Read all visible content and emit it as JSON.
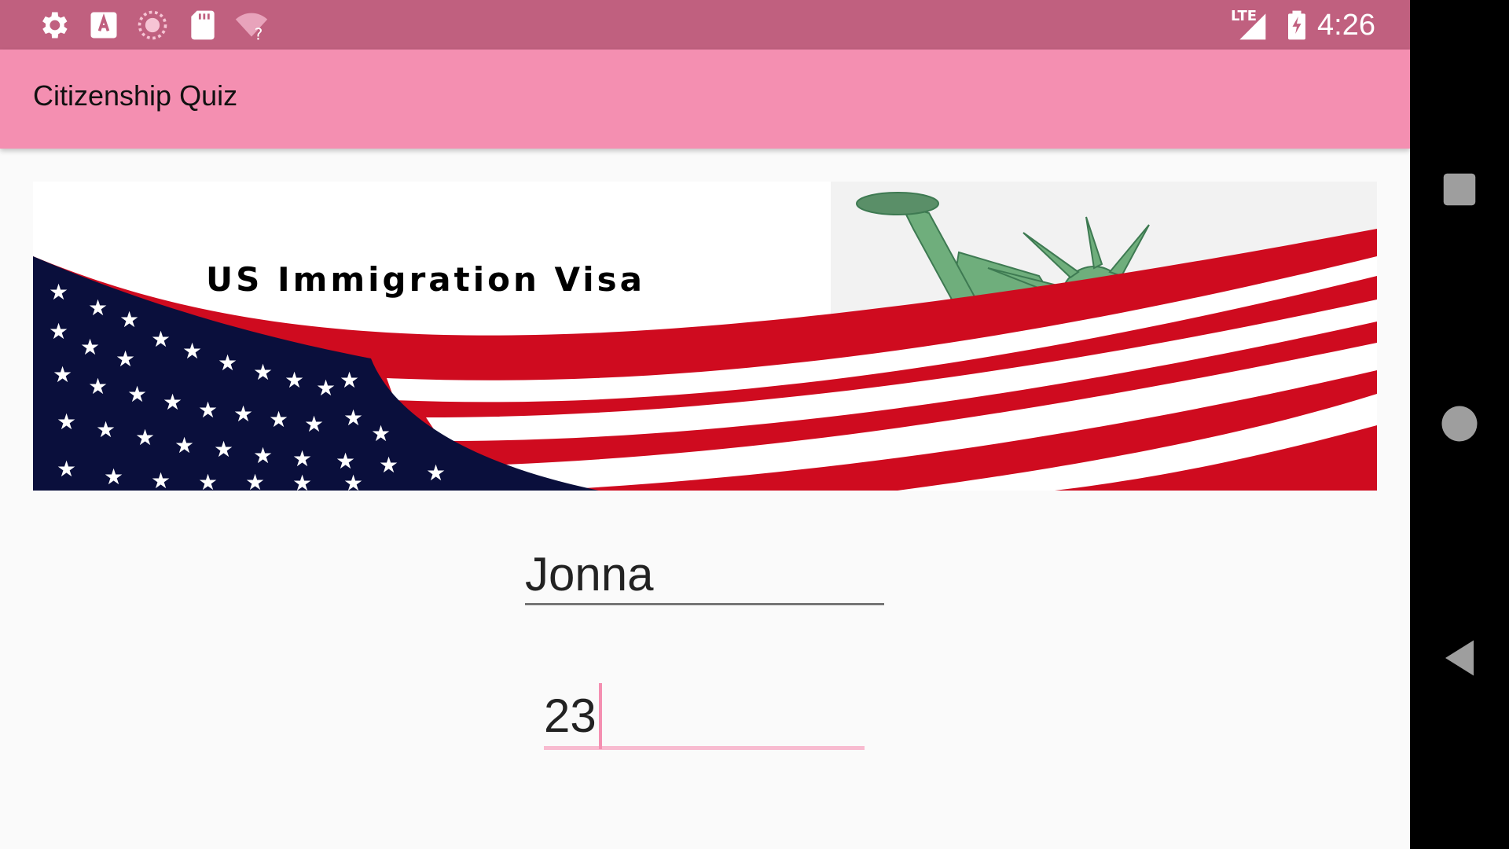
{
  "status_bar": {
    "time": "4:26",
    "network_label": "LTE",
    "left_icons": [
      "settings-icon",
      "keyboard-a-icon",
      "sync-icon",
      "sd-card-icon",
      "wifi-unknown-icon"
    ],
    "right_icons": [
      "signal-icon",
      "battery-charging-icon"
    ]
  },
  "app_bar": {
    "title": "Citizenship Quiz"
  },
  "banner": {
    "text": "US Immigration Visa",
    "image": "us-flag-statue-of-liberty-banner"
  },
  "form": {
    "name_value": "Jonna",
    "age_value": "23"
  },
  "nav_bar": {
    "buttons": [
      "recents-button",
      "home-button",
      "back-button"
    ]
  },
  "colors": {
    "status_bar": "#c0607f",
    "app_bar": "#f48fb1",
    "accent": "#f8bbd0",
    "flag_red": "#cf0b1f",
    "flag_blue": "#0a0f3c"
  }
}
